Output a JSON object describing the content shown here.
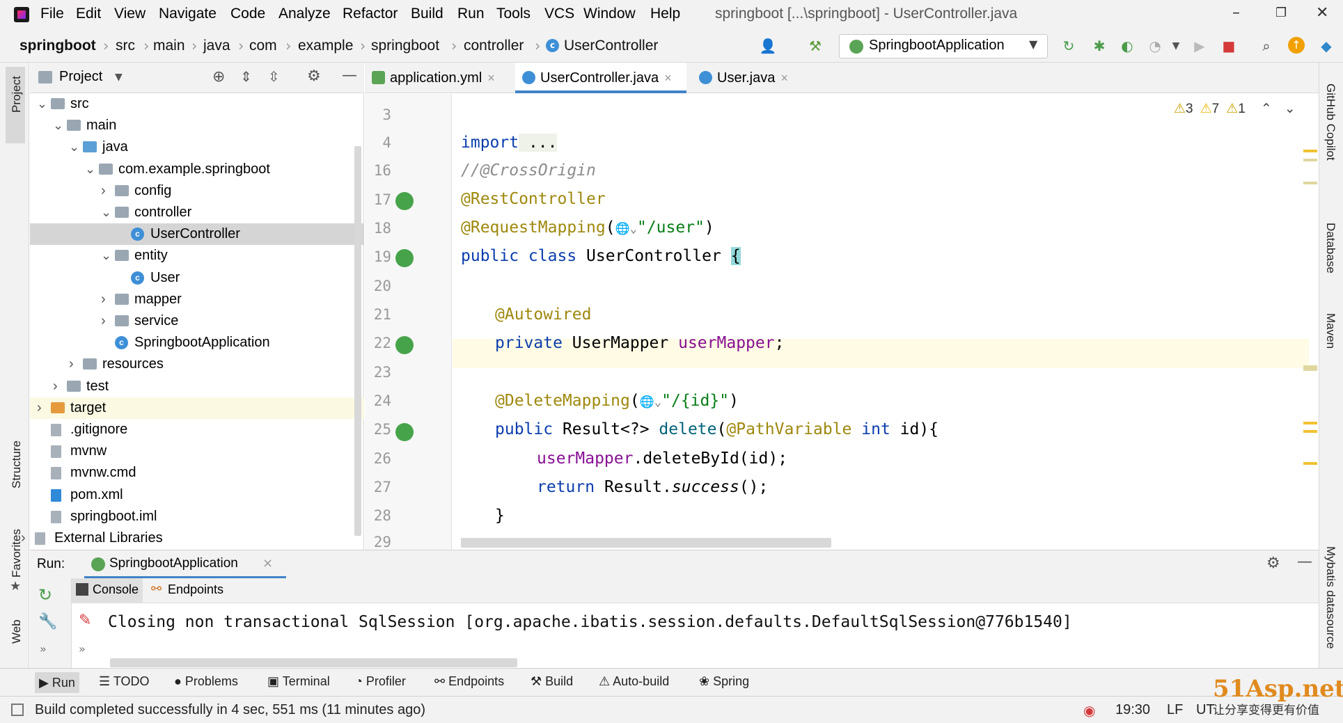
{
  "menubar": {
    "items": [
      "File",
      "Edit",
      "View",
      "Navigate",
      "Code",
      "Analyze",
      "Refactor",
      "Build",
      "Run",
      "Tools",
      "VCS",
      "Window",
      "Help"
    ],
    "title": "springboot [...\\springboot] - UserController.java",
    "minimize": "–",
    "maximize": "❐",
    "close": "✕"
  },
  "breadcrumb": [
    "springboot",
    "src",
    "main",
    "java",
    "com",
    "example",
    "springboot",
    "controller",
    "UserController"
  ],
  "run_config": "SpringbootApplication",
  "left_strip": {
    "project": "Project",
    "structure": "Structure",
    "favorites": "Favorites",
    "web": "Web"
  },
  "right_strip": {
    "copilot": "GitHub Copilot",
    "database": "Database",
    "maven": "Maven",
    "mybatis": "Mybatis datasource"
  },
  "project": {
    "title": "Project",
    "tree": [
      {
        "label": "src",
        "indent": 0,
        "arrow": "⌄",
        "icon": "folder"
      },
      {
        "label": "main",
        "indent": 1,
        "arrow": "⌄",
        "icon": "folder"
      },
      {
        "label": "java",
        "indent": 2,
        "arrow": "⌄",
        "icon": "folder-blue"
      },
      {
        "label": "com.example.springboot",
        "indent": 3,
        "arrow": "⌄",
        "icon": "folder"
      },
      {
        "label": "config",
        "indent": 4,
        "arrow": "›",
        "icon": "folder"
      },
      {
        "label": "controller",
        "indent": 4,
        "arrow": "⌄",
        "icon": "folder"
      },
      {
        "label": "UserController",
        "indent": 5,
        "arrow": "",
        "icon": "class"
      },
      {
        "label": "entity",
        "indent": 4,
        "arrow": "⌄",
        "icon": "folder"
      },
      {
        "label": "User",
        "indent": 5,
        "arrow": "",
        "icon": "class"
      },
      {
        "label": "mapper",
        "indent": 4,
        "arrow": "›",
        "icon": "folder"
      },
      {
        "label": "service",
        "indent": 4,
        "arrow": "›",
        "icon": "folder"
      },
      {
        "label": "SpringbootApplication",
        "indent": 4,
        "arrow": "",
        "icon": "class"
      },
      {
        "label": "resources",
        "indent": 2,
        "arrow": "›",
        "icon": "folder"
      },
      {
        "label": "test",
        "indent": 1,
        "arrow": "›",
        "icon": "folder"
      },
      {
        "label": "target",
        "indent": 0,
        "arrow": "›",
        "icon": "folder-orange"
      },
      {
        "label": ".gitignore",
        "indent": 0,
        "arrow": "",
        "icon": "file"
      },
      {
        "label": "mvnw",
        "indent": 0,
        "arrow": "",
        "icon": "file"
      },
      {
        "label": "mvnw.cmd",
        "indent": 0,
        "arrow": "",
        "icon": "file"
      },
      {
        "label": "pom.xml",
        "indent": 0,
        "arrow": "",
        "icon": "maven"
      },
      {
        "label": "springboot.iml",
        "indent": 0,
        "arrow": "",
        "icon": "file"
      },
      {
        "label": "External Libraries",
        "indent": -1,
        "arrow": "›",
        "icon": "libs"
      }
    ]
  },
  "tabs": [
    {
      "label": "application.yml",
      "close": "×"
    },
    {
      "label": "UserController.java",
      "close": "×"
    },
    {
      "label": "User.java",
      "close": "×"
    }
  ],
  "inspections": {
    "warn_a": "3",
    "warn_b": "7",
    "weak": "1"
  },
  "line_numbers": [
    "3",
    "4",
    "16",
    "17",
    "18",
    "19",
    "20",
    "21",
    "22",
    "23",
    "24",
    "25",
    "26",
    "27",
    "28",
    "29"
  ],
  "code": {
    "l4_kw": "import",
    "l4_rest": " ...",
    "l16": "//@CrossOrigin",
    "l17": "@RestController",
    "l18_ann": "@RequestMapping",
    "l18_mid": "(",
    "l18_glyph": "🌐⌄",
    "l18_str": "\"/user\"",
    "l18_end": ")",
    "l19_kw": "public class ",
    "l19_name": "UserController ",
    "l19_brace": "{",
    "l21": "@Autowired",
    "l22_kw": "private ",
    "l22_type": "UserMapper ",
    "l22_fld": "userMapper",
    "l22_end": ";",
    "l24_ann": "@DeleteMapping",
    "l24_mid": "(",
    "l24_glyph": "🌐⌄",
    "l24_str": "\"/{id}\"",
    "l24_end": ")",
    "l25_kw": "public ",
    "l25_type": "Result<?> ",
    "l25_m": "delete",
    "l25_p": "(",
    "l25_ann": "@PathVariable ",
    "l25_int": "int ",
    "l25_end": "id){",
    "l26_fld": "userMapper",
    "l26_rest": ".deleteById(id);",
    "l27_kw": "return ",
    "l27_a": "Result.",
    "l27_m": "success",
    "l27_end": "();",
    "l28": "}"
  },
  "run": {
    "label": "Run:",
    "config": "SpringbootApplication",
    "close": "×",
    "console_tab": "Console",
    "endpoints_tab": "Endpoints",
    "output": "Closing non transactional SqlSession [org.apache.ibatis.session.defaults.DefaultSqlSession@776b1540]"
  },
  "toolwindows": [
    "Run",
    "TODO",
    "Problems",
    "Terminal",
    "Profiler",
    "Endpoints",
    "Build",
    "Auto-build",
    "Spring"
  ],
  "status": {
    "message": "Build completed successfully in 4 sec, 551 ms (11 minutes ago)",
    "time": "19:30",
    "lf": "LF",
    "enc": "UT"
  },
  "watermark": {
    "brand": "51Asp.net",
    "slogan": "让分享变得更有价值"
  },
  "colors": {
    "accent": "#4083c9",
    "keyword": "#0a3dad",
    "annotation": "#9e880d",
    "string": "#067d17",
    "field": "#871094"
  }
}
